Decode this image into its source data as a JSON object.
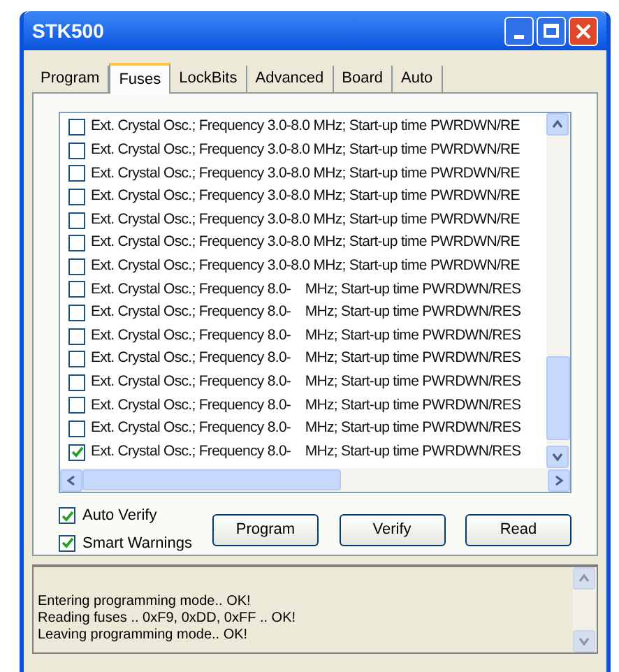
{
  "window": {
    "title": "STK500"
  },
  "tabs": [
    {
      "label": "Program",
      "selected": false
    },
    {
      "label": "Fuses",
      "selected": true
    },
    {
      "label": "LockBits",
      "selected": false
    },
    {
      "label": "Advanced",
      "selected": false
    },
    {
      "label": "Board",
      "selected": false
    },
    {
      "label": "Auto",
      "selected": false
    }
  ],
  "fuse_list": [
    {
      "label": "Ext. Crystal Osc.; Frequency 3.0-8.0 MHz; Start-up time PWRDWN/RE",
      "checked": false
    },
    {
      "label": "Ext. Crystal Osc.; Frequency 3.0-8.0 MHz; Start-up time PWRDWN/RE",
      "checked": false
    },
    {
      "label": "Ext. Crystal Osc.; Frequency 3.0-8.0 MHz; Start-up time PWRDWN/RE",
      "checked": false
    },
    {
      "label": "Ext. Crystal Osc.; Frequency 3.0-8.0 MHz; Start-up time PWRDWN/RE",
      "checked": false
    },
    {
      "label": "Ext. Crystal Osc.; Frequency 3.0-8.0 MHz; Start-up time PWRDWN/RE",
      "checked": false
    },
    {
      "label": "Ext. Crystal Osc.; Frequency 3.0-8.0 MHz; Start-up time PWRDWN/RE",
      "checked": false
    },
    {
      "label": "Ext. Crystal Osc.; Frequency 3.0-8.0 MHz; Start-up time PWRDWN/RE",
      "checked": false
    },
    {
      "label": "Ext. Crystal Osc.; Frequency 8.0-    MHz; Start-up time PWRDWN/RES",
      "checked": false
    },
    {
      "label": "Ext. Crystal Osc.; Frequency 8.0-    MHz; Start-up time PWRDWN/RES",
      "checked": false
    },
    {
      "label": "Ext. Crystal Osc.; Frequency 8.0-    MHz; Start-up time PWRDWN/RES",
      "checked": false
    },
    {
      "label": "Ext. Crystal Osc.; Frequency 8.0-    MHz; Start-up time PWRDWN/RES",
      "checked": false
    },
    {
      "label": "Ext. Crystal Osc.; Frequency 8.0-    MHz; Start-up time PWRDWN/RES",
      "checked": false
    },
    {
      "label": "Ext. Crystal Osc.; Frequency 8.0-    MHz; Start-up time PWRDWN/RES",
      "checked": false
    },
    {
      "label": "Ext. Crystal Osc.; Frequency 8.0-    MHz; Start-up time PWRDWN/RES",
      "checked": false
    },
    {
      "label": "Ext. Crystal Osc.; Frequency 8.0-    MHz; Start-up time PWRDWN/RES",
      "checked": true
    }
  ],
  "options": [
    {
      "label": "Auto Verify",
      "checked": true
    },
    {
      "label": "Smart Warnings",
      "checked": true
    }
  ],
  "buttons": [
    "Program",
    "Verify",
    "Read"
  ],
  "log": [
    "Entering programming mode.. OK!",
    "Reading fuses .. 0xF9, 0xDD, 0xFF .. OK!",
    "Leaving programming mode.. OK!"
  ]
}
